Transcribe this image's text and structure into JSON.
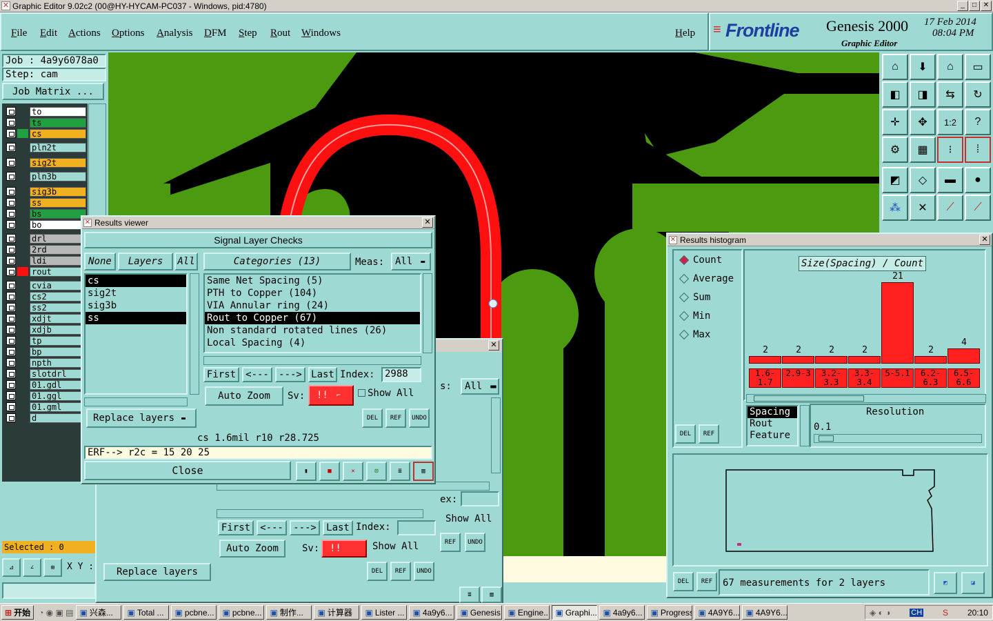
{
  "window": {
    "title": "Graphic Editor 9.02c2 (00@HY-HYCAM-PC037 - Windows, pid:4780)"
  },
  "menu": [
    "File",
    "Edit",
    "Actions",
    "Options",
    "Analysis",
    "DFM",
    "Step",
    "Rout",
    "Windows"
  ],
  "help": "Help",
  "logo": {
    "brand": "Frontline",
    "product": "Genesis 2000",
    "subtitle": "Graphic Editor",
    "date": "17 Feb 2014",
    "time": "08:04 PM"
  },
  "job": {
    "job_label": "Job : 4a9y6078a0",
    "step_label": "Step: cam",
    "matrix_button": "Job Matrix ..."
  },
  "layers": [
    {
      "name": "to",
      "color": "#ffffff"
    },
    {
      "name": "ts",
      "color": "#20a040"
    },
    {
      "name": "cs",
      "color": "#f0b020"
    },
    {
      "name": "pln2t",
      "color": "#9fd9d4"
    },
    {
      "name": "sig2t",
      "color": "#f0b020"
    },
    {
      "name": "pln3b",
      "color": "#9fd9d4"
    },
    {
      "name": "sig3b",
      "color": "#f0b020"
    },
    {
      "name": "ss",
      "color": "#f0b020"
    },
    {
      "name": "bs",
      "color": "#20a040"
    },
    {
      "name": "bo",
      "color": "#ffffff"
    },
    {
      "name": "drl",
      "color": "#b8b8b8"
    },
    {
      "name": "2rd",
      "color": "#b8b8b8"
    },
    {
      "name": "ldi",
      "color": "#b8b8b8"
    },
    {
      "name": "rout",
      "color": "#9fd9d4"
    },
    {
      "name": "cvia",
      "color": "#9fd9d4"
    },
    {
      "name": "cs2",
      "color": "#9fd9d4"
    },
    {
      "name": "ss2",
      "color": "#9fd9d4"
    },
    {
      "name": "xdjt",
      "color": "#9fd9d4"
    },
    {
      "name": "xdjb",
      "color": "#9fd9d4"
    },
    {
      "name": "tp",
      "color": "#9fd9d4"
    },
    {
      "name": "bp",
      "color": "#9fd9d4"
    },
    {
      "name": "npth",
      "color": "#9fd9d4"
    },
    {
      "name": "slotdrl",
      "color": "#9fd9d4"
    },
    {
      "name": "01.gdl",
      "color": "#9fd9d4"
    },
    {
      "name": "01.ggl",
      "color": "#9fd9d4"
    },
    {
      "name": "01.gml",
      "color": "#9fd9d4"
    },
    {
      "name": "d",
      "color": "#9fd9d4"
    }
  ],
  "selected": "Selected : 0",
  "xy_label": "X Y :",
  "results_viewer": {
    "title": "Results viewer",
    "header": "Signal Layer Checks",
    "none_btn": "None",
    "layers_btn": "Layers",
    "all_btn": "All",
    "layer_list": [
      "cs",
      "sig2t",
      "sig3b",
      "ss"
    ],
    "categories_btn": "Categories (13)",
    "meas_label": "Meas:",
    "meas_value": "All",
    "categories": [
      "Same Net Spacing (5)",
      "PTH to Copper (104)",
      "VIA Annular ring (24)",
      "Rout to Copper (67)",
      "Non standard rotated lines (26)",
      "Local Spacing (4)"
    ],
    "nav": [
      "First",
      "<---",
      "--->",
      "Last"
    ],
    "index_label": "Index:",
    "index_value": "2988",
    "zoom": "Auto Zoom",
    "sv_label": "Sv:",
    "sv_value": "!!",
    "show_all": "Show All",
    "replace": "Replace layers",
    "status": "cs 1.6mil  r10  r28.725",
    "erf": "ERF--> r2c = 15 20 25",
    "close": "Close",
    "del": "DEL",
    "ref": "REF",
    "undo": "UNDO"
  },
  "back_viewer": {
    "all": "All",
    "ex": "ex:",
    "show_all": "Show All",
    "nav": [
      "First",
      "<---",
      "--->",
      "Last"
    ],
    "index_label": "Index:",
    "zoom": "Auto Zoom",
    "sv_label": "Sv:",
    "sv_value": "!!",
    "replace": "Replace layers",
    "meas_frag": "s:"
  },
  "histogram": {
    "title": "Results histogram",
    "modes": [
      "Count",
      "Average",
      "Sum",
      "Min",
      "Max"
    ],
    "heading": "Size(Spacing) / Count",
    "values": [
      2,
      2,
      2,
      2,
      21,
      2,
      4
    ],
    "categories": [
      "1.6-1.7",
      "2.9-3",
      "3.2-3.3",
      "3.3-3.4",
      "5-5.1",
      "6.2-6.3",
      "6.5-6.6"
    ],
    "sort_list": [
      "Spacing",
      "Rout",
      "Feature"
    ],
    "resolution_label": "Resolution",
    "resolution_value": "0.1",
    "summary": "67 measurements for 2 layers",
    "del": "DEL",
    "ref": "REF"
  },
  "taskbar": {
    "start": "开始",
    "items": [
      "兴森...",
      "Total ...",
      "pcbne...",
      "pcbne...",
      "制作...",
      "计算器",
      "Lister ...",
      "4a9y6...",
      "Genesis",
      "Engine...",
      "Graphi...",
      "4a9y6...",
      "Progress",
      "4A9Y6...",
      "4A9Y6..."
    ],
    "active_index": 10,
    "clock": "20:10",
    "tray_ch": "CH"
  }
}
